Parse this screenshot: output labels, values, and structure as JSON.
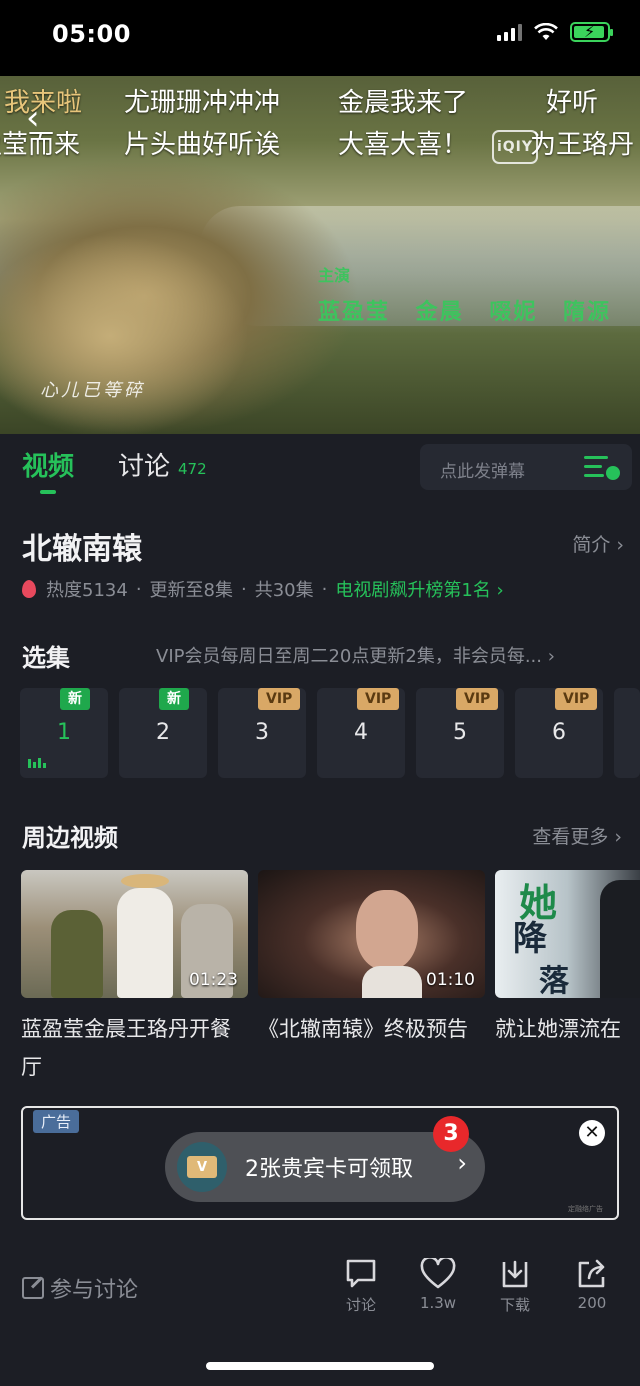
{
  "status_bar": {
    "time": "05:00"
  },
  "video": {
    "danmu": [
      {
        "text": "我来啦",
        "style": "gold"
      },
      {
        "text": "尤珊珊冲冲冲",
        "style": "white"
      },
      {
        "text": "金晨我来了",
        "style": "white"
      },
      {
        "text": "好听",
        "style": "white"
      },
      {
        "text": "盈莹而来",
        "style": "white"
      },
      {
        "text": "片头曲好听诶",
        "style": "white"
      },
      {
        "text": "大喜大喜！",
        "style": "white"
      },
      {
        "text": "为王珞丹",
        "style": "white"
      }
    ],
    "watermark": "iQIYI 爱奇艺",
    "credit_heading": "主演",
    "credit_names": "蓝盈莹 金晨 啜妮 隋源",
    "subtitle": "心儿已等碎"
  },
  "tabs": {
    "video_label": "视频",
    "discuss_label": "讨论",
    "discuss_count": "472",
    "danmu_placeholder": "点此发弹幕"
  },
  "show": {
    "title": "北辙南辕",
    "intro_label": "简介 ›",
    "heat": "热度5134",
    "update_status": "更新至8集",
    "total_episodes": "共30集",
    "rank": "电视剧飙升榜第1名 ›"
  },
  "episodes": {
    "section_title": "选集",
    "note": "VIP会员每周日至周二20点更新2集，非会员每... ›",
    "items": [
      {
        "number": "1",
        "badge": "新",
        "badge_type": "new",
        "playing": true
      },
      {
        "number": "2",
        "badge": "新",
        "badge_type": "new",
        "playing": false
      },
      {
        "number": "3",
        "badge": "VIP",
        "badge_type": "vip",
        "playing": false
      },
      {
        "number": "4",
        "badge": "VIP",
        "badge_type": "vip",
        "playing": false
      },
      {
        "number": "5",
        "badge": "VIP",
        "badge_type": "vip",
        "playing": false
      },
      {
        "number": "6",
        "badge": "VIP",
        "badge_type": "vip",
        "playing": false
      }
    ]
  },
  "related": {
    "section_title": "周边视频",
    "more_label": "查看更多 ›",
    "items": [
      {
        "title": "蓝盈莹金晨王珞丹开餐厅",
        "duration": "01:23"
      },
      {
        "title": "《北辙南辕》终极预告",
        "duration": "01:10"
      },
      {
        "title": "就让她漂流在",
        "duration": "",
        "overlay_text": "她 让 降落"
      }
    ]
  },
  "ad": {
    "tag": "广告",
    "badge_count": "3",
    "text": "2张贵宾卡可领取",
    "card_letter": "V",
    "fine_print": "定融络广告"
  },
  "bottom_bar": {
    "discuss_placeholder": "参与讨论",
    "actions": [
      {
        "icon": "comment-icon",
        "label": "讨论"
      },
      {
        "icon": "heart-icon",
        "label": "1.3w"
      },
      {
        "icon": "download-icon",
        "label": "下载"
      },
      {
        "icon": "share-icon",
        "label": "200"
      }
    ]
  },
  "colors": {
    "accent_green": "#26c15a",
    "background": "#1c1e25",
    "vip_gold": "#d9a866",
    "ad_badge_red": "#e8282b"
  }
}
